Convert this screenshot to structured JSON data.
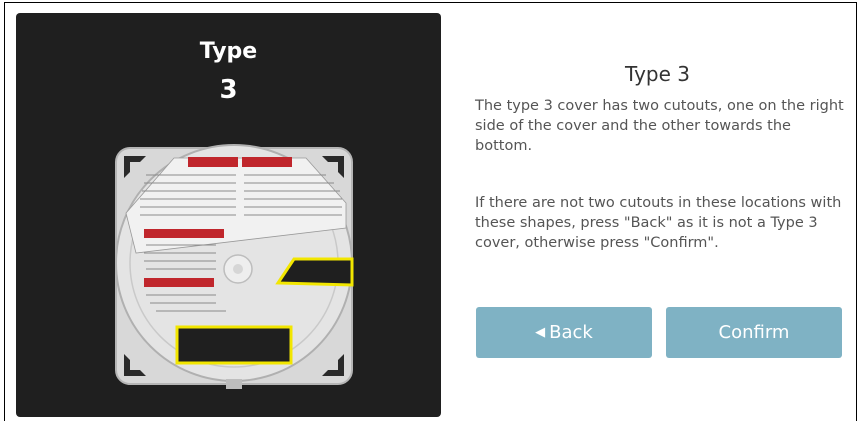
{
  "image_panel": {
    "title_line1": "Type",
    "title_line2": "3"
  },
  "info": {
    "title": "Type 3",
    "paragraph1": "The type 3 cover has two cutouts, one on the right side of the cover and the other towards the bottom.",
    "paragraph2": "If there are not two cutouts in these locations with these shapes, press \"Back\" as it is not a Type 3 cover, otherwise press \"Confirm\"."
  },
  "buttons": {
    "back_label": "Back",
    "back_icon": "left-triangle-icon",
    "confirm_label": "Confirm"
  },
  "colors": {
    "panel_bg": "#1f1f1f",
    "button_bg": "#7fb2c4",
    "highlight": "#f2e600"
  }
}
